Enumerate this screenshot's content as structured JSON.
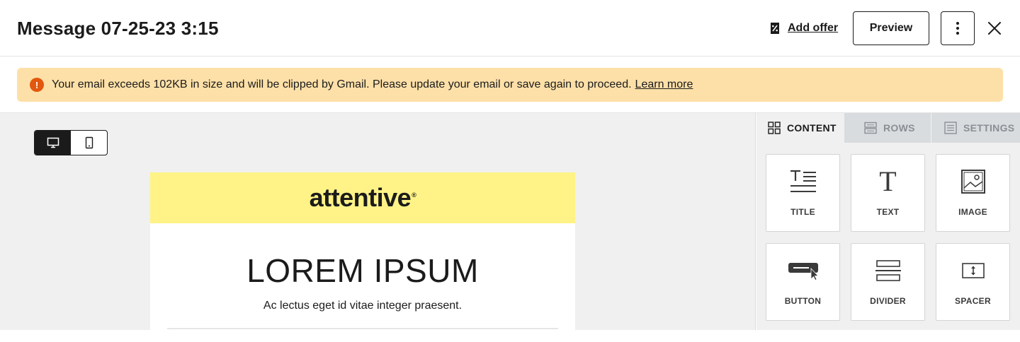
{
  "header": {
    "title": "Message 07-25-23 3:15",
    "add_offer_label": "Add offer",
    "preview_label": "Preview"
  },
  "banner": {
    "message": "Your email exceeds 102KB in size and will be clipped by Gmail. Please update your email or save again to proceed.",
    "link": "Learn more",
    "warning_glyph": "!",
    "color": "#fde0a8",
    "icon_color": "#e2580e"
  },
  "email": {
    "brand": "attentive",
    "brand_mark": "®",
    "headline": "LOREM IPSUM",
    "subtext": "Ac lectus eget id vitae integer praesent.",
    "brand_color": "#fff387"
  },
  "panel": {
    "tabs": [
      {
        "label": "CONTENT",
        "icon": "grid-icon",
        "active": true
      },
      {
        "label": "ROWS",
        "icon": "rows-icon",
        "active": false
      },
      {
        "label": "SETTINGS",
        "icon": "settings-list-icon",
        "active": false
      }
    ],
    "blocks": [
      {
        "label": "TITLE",
        "icon": "title-icon"
      },
      {
        "label": "TEXT",
        "icon": "text-icon"
      },
      {
        "label": "IMAGE",
        "icon": "image-icon"
      },
      {
        "label": "BUTTON",
        "icon": "button-icon"
      },
      {
        "label": "DIVIDER",
        "icon": "divider-icon"
      },
      {
        "label": "SPACER",
        "icon": "spacer-icon"
      }
    ]
  },
  "device_toggle": {
    "active": "desktop",
    "options": [
      "desktop-icon",
      "mobile-icon"
    ]
  }
}
